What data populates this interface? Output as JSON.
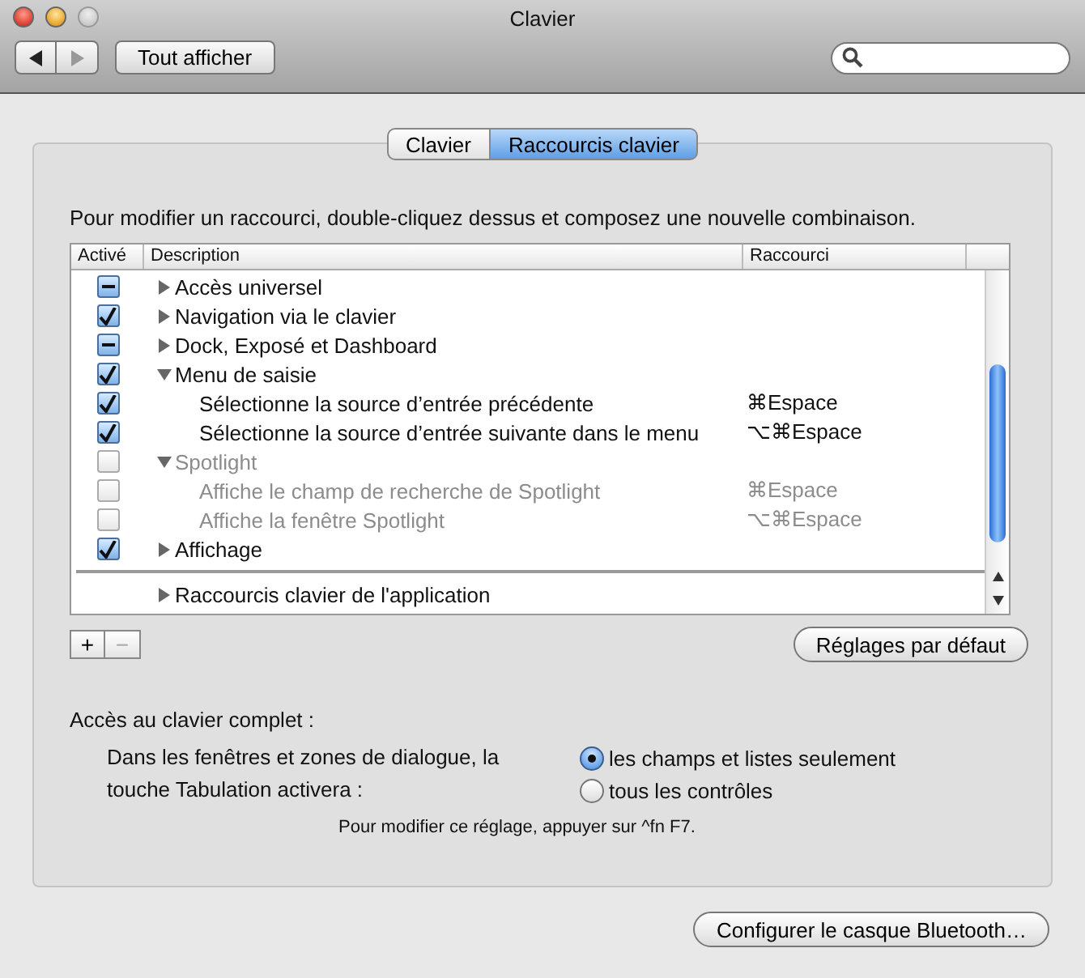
{
  "window": {
    "title": "Clavier"
  },
  "toolbar": {
    "show_all": "Tout afficher"
  },
  "tabs": [
    {
      "label": "Clavier",
      "selected": false
    },
    {
      "label": "Raccourcis clavier",
      "selected": true
    }
  ],
  "instructions": "Pour modifier un raccourci, double-cliquez dessus et composez une nouvelle combinaison.",
  "table": {
    "columns": [
      "Activé",
      "Description",
      "Raccourci"
    ],
    "rows": [
      {
        "label": "Accès universel",
        "checked": true,
        "mixed": true,
        "disabled": false,
        "expanded": false
      },
      {
        "label": "Navigation via le clavier",
        "checked": true,
        "mixed": false,
        "disabled": false,
        "expanded": false
      },
      {
        "label": "Dock, Exposé et Dashboard",
        "checked": true,
        "mixed": true,
        "disabled": false,
        "expanded": false
      },
      {
        "label": "Menu de saisie",
        "checked": true,
        "mixed": false,
        "disabled": false,
        "expanded": true,
        "children": [
          {
            "label": "Sélectionne la source d’entrée précédente",
            "shortcut": "⌘Espace",
            "checked": true,
            "mixed": false,
            "disabled": false
          },
          {
            "label": "Sélectionne la source d’entrée suivante dans le menu",
            "shortcut": "⌥⌘Espace",
            "checked": true,
            "mixed": false,
            "disabled": false
          }
        ]
      },
      {
        "label": "Spotlight",
        "checked": false,
        "mixed": false,
        "disabled": true,
        "expanded": true,
        "children": [
          {
            "label": "Affiche le champ de recherche de Spotlight",
            "shortcut": "⌘Espace",
            "checked": false,
            "mixed": false,
            "disabled": true
          },
          {
            "label": "Affiche la fenêtre Spotlight",
            "shortcut": "⌥⌘Espace",
            "checked": false,
            "mixed": false,
            "disabled": true
          }
        ]
      },
      {
        "label": "Affichage",
        "checked": true,
        "mixed": false,
        "disabled": false,
        "expanded": false
      }
    ],
    "app_section": {
      "label": "Raccourcis clavier de l'application",
      "expanded": false
    }
  },
  "add_button": "+",
  "remove_button": {
    "label": "−",
    "disabled": true
  },
  "defaults_button": "Réglages par défaut",
  "full_keyboard_access": {
    "title": "Accès au clavier complet :",
    "prompt": "Dans les fenêtres et zones de dialogue, la touche Tabulation activera :",
    "options": [
      {
        "label": "les champs et listes seulement",
        "selected": true
      },
      {
        "label": "tous les contrôles",
        "selected": false
      }
    ],
    "hint": "Pour modifier ce réglage, appuyer sur ^fn F7."
  },
  "bluetooth_button": "Configurer le casque Bluetooth…"
}
